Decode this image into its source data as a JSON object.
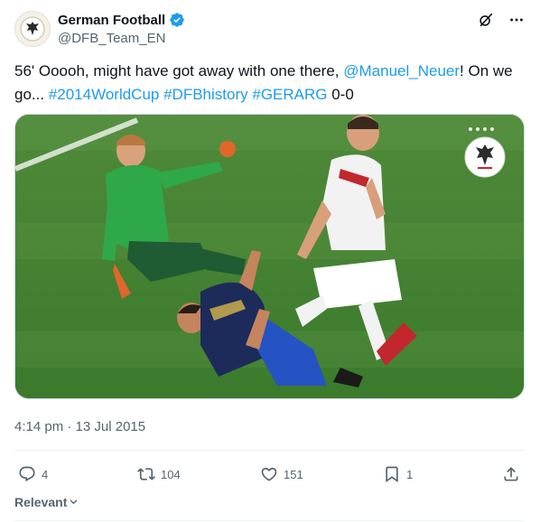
{
  "author": {
    "display_name": "German Football",
    "handle": "@DFB_Team_EN"
  },
  "tweet": {
    "text_1": "56' Ooooh, might have got away with one there, ",
    "mention": "@Manuel_Neuer",
    "text_2": "! On we go... ",
    "hashtag_1": "#2014WorldCup",
    "hashtag_2": "#DFBhistory",
    "hashtag_3": "#GERARG",
    "text_3": " 0-0"
  },
  "timestamp": "4:14 pm · 13 Jul 2015",
  "actions": {
    "replies": "4",
    "retweets": "104",
    "likes": "151",
    "bookmarks": "1"
  },
  "sort": {
    "label": "Relevant"
  },
  "colors": {
    "link": "#1d9bf0",
    "secondary_text": "#536471",
    "verified": "#1d9bf0"
  }
}
